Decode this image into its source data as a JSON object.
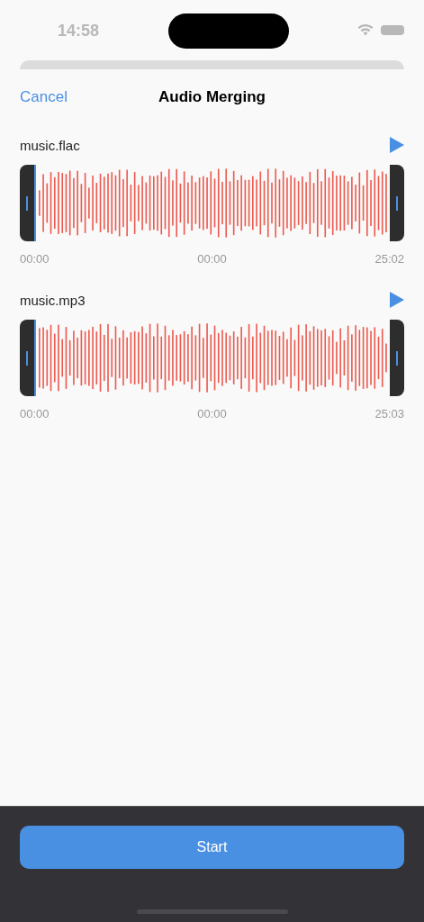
{
  "status_bar": {
    "time": "14:58"
  },
  "nav": {
    "cancel": "Cancel",
    "title": "Audio Merging"
  },
  "tracks": [
    {
      "name": "music.flac",
      "start": "00:00",
      "current": "00:00",
      "end": "25:02"
    },
    {
      "name": "music.mp3",
      "start": "00:00",
      "current": "00:00",
      "end": "25:03"
    }
  ],
  "button": "Start"
}
